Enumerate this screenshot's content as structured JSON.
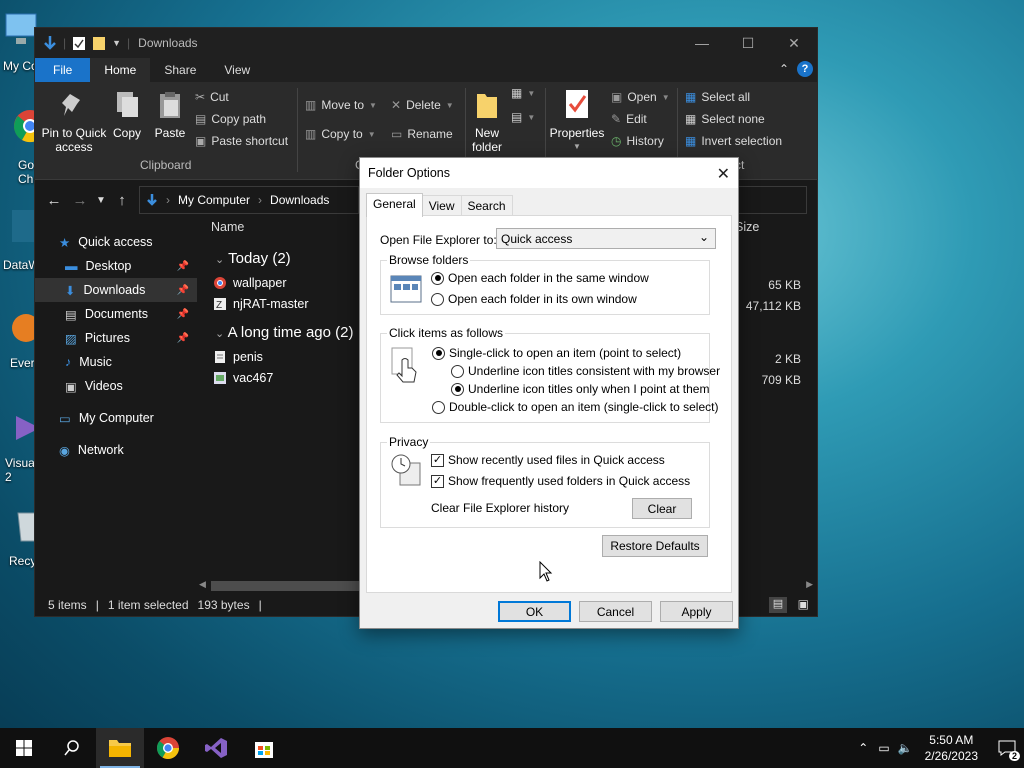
{
  "desktop": {
    "icons": [
      "My Co",
      "Go Chr",
      "DataW",
      "Ever",
      "Visua 2",
      "Recy"
    ]
  },
  "explorer": {
    "title": "Downloads",
    "tabs": {
      "file": "File",
      "home": "Home",
      "share": "Share",
      "view": "View"
    },
    "help": "?",
    "ribbon": {
      "pin": "Pin to Quick access",
      "copy": "Copy",
      "paste": "Paste",
      "cut": "Cut",
      "copy_path": "Copy path",
      "paste_shortcut": "Paste shortcut",
      "clipboard_group": "Clipboard",
      "move_to": "Move to",
      "copy_to": "Copy to",
      "delete": "Delete",
      "rename": "Rename",
      "new_folder": "New folder",
      "properties": "Properties",
      "open": "Open",
      "edit": "Edit",
      "history": "History",
      "select_all": "Select all",
      "select_none": "Select none",
      "invert_selection": "Invert selection",
      "org_group_partial": "C",
      "select_group_partial": "ct"
    },
    "address": {
      "root": "My Computer",
      "sep": "›",
      "current": "Downloads"
    },
    "nav": {
      "quick_access": "Quick access",
      "desktop": "Desktop",
      "downloads": "Downloads",
      "documents": "Documents",
      "pictures": "Pictures",
      "music": "Music",
      "videos": "Videos",
      "my_computer": "My Computer",
      "network": "Network"
    },
    "columns": {
      "name": "Name",
      "size": "Size"
    },
    "groups": [
      {
        "label": "Today (2)",
        "files": [
          {
            "name": "wallpaper",
            "size": "65 KB"
          },
          {
            "name": "njRAT-master",
            "size": "47,112 KB"
          }
        ]
      },
      {
        "label": "A long time ago (2)",
        "files": [
          {
            "name": "penis",
            "size": "2 KB"
          },
          {
            "name": "vac467",
            "size": "709 KB"
          }
        ]
      }
    ],
    "status": {
      "items": "5 items",
      "sep": "|",
      "selected": "1 item selected",
      "bytes": "193 bytes"
    }
  },
  "dialog": {
    "title": "Folder Options",
    "tabs": {
      "general": "General",
      "view": "View",
      "search": "Search"
    },
    "open_to_label": "Open File Explorer to:",
    "open_to_value": "Quick access",
    "browse": {
      "legend": "Browse folders",
      "same_window": "Open each folder in the same window",
      "own_window": "Open each folder in its own window"
    },
    "click": {
      "legend": "Click items as follows",
      "single": "Single-click to open an item (point to select)",
      "underline_browser": "Underline icon titles consistent with my browser",
      "underline_point": "Underline icon titles only when I point at them",
      "double": "Double-click to open an item (single-click to select)"
    },
    "privacy": {
      "legend": "Privacy",
      "recent_files": "Show recently used files in Quick access",
      "frequent_folders": "Show frequently used folders in Quick access",
      "clear_label": "Clear File Explorer history",
      "clear_btn": "Clear"
    },
    "restore_defaults": "Restore Defaults",
    "ok": "OK",
    "cancel": "Cancel",
    "apply": "Apply"
  },
  "taskbar": {
    "time": "5:50 AM",
    "date": "2/26/2023",
    "notifications": "2"
  }
}
